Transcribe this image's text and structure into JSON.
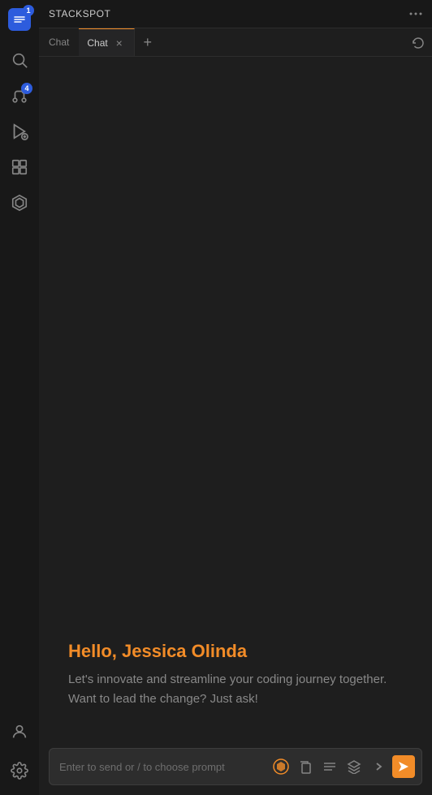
{
  "app": {
    "title": "STACKSPOT",
    "more_label": "···"
  },
  "activity_bar": {
    "logo_badge": "1",
    "notifications_badge": "4",
    "icons": [
      {
        "name": "logo",
        "symbol": "⬡",
        "badge": "1"
      },
      {
        "name": "search",
        "symbol": "🔍"
      },
      {
        "name": "source-control",
        "symbol": "⑂",
        "badge": "4"
      },
      {
        "name": "run",
        "symbol": "▶"
      },
      {
        "name": "extensions",
        "symbol": "⊞"
      },
      {
        "name": "stackspot",
        "symbol": "⬡"
      }
    ],
    "bottom_icons": [
      {
        "name": "account",
        "symbol": "👤"
      },
      {
        "name": "settings",
        "symbol": "⚙"
      }
    ]
  },
  "tabs": {
    "inactive_label": "Chat",
    "active_tab": {
      "label": "Chat",
      "closeable": true
    },
    "add_label": "+",
    "history_icon": "⟲"
  },
  "chat": {
    "welcome_greeting": "Hello, Jessica Olinda",
    "welcome_body": "Let's innovate and streamline your coding journey together. Want to lead the change? Just ask!"
  },
  "input": {
    "placeholder": "Enter to send or / to choose prompt",
    "actions": {
      "icon1": "●",
      "icon2": "⊡",
      "icon3": "☰",
      "icon4": "⊛",
      "icon5": "›",
      "send": "➤"
    }
  }
}
